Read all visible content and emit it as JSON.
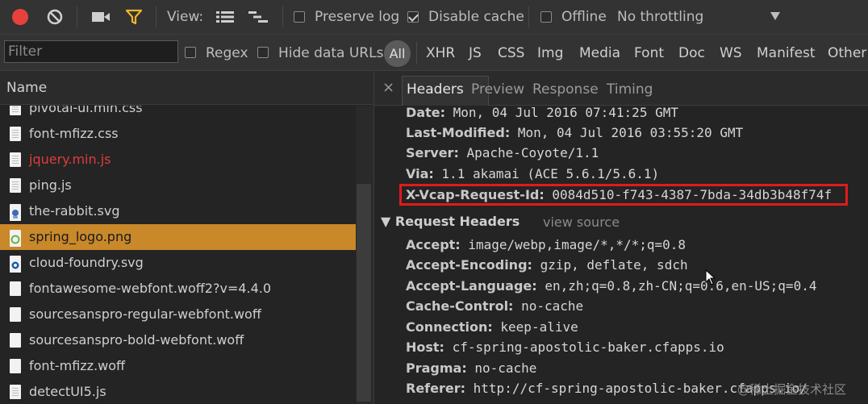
{
  "toolbar": {
    "view_label": "View:",
    "preserve_log": {
      "label": "Preserve log",
      "checked": false
    },
    "disable_cache": {
      "label": "Disable cache",
      "checked": true
    },
    "offline": {
      "label": "Offline",
      "checked": false
    },
    "throttling": "No throttling"
  },
  "filter_bar": {
    "filter_placeholder": "Filter",
    "regex": {
      "label": "Regex",
      "checked": false
    },
    "hide_data_urls": {
      "label": "Hide data URLs",
      "checked": false
    },
    "types": [
      "All",
      "XHR",
      "JS",
      "CSS",
      "Img",
      "Media",
      "Font",
      "Doc",
      "WS",
      "Manifest",
      "Other"
    ],
    "active_type": "All"
  },
  "request_list": {
    "header": "Name",
    "items": [
      {
        "name": "pivotal-ui.min.css",
        "icon": "doc-icon"
      },
      {
        "name": "font-mfizz.css",
        "icon": "doc-icon"
      },
      {
        "name": "jquery.min.js",
        "icon": "doc-icon",
        "status": "error"
      },
      {
        "name": "ping.js",
        "icon": "doc-icon"
      },
      {
        "name": "the-rabbit.svg",
        "icon": "svg-image-icon"
      },
      {
        "name": "spring_logo.png",
        "icon": "spring-logo-icon",
        "selected": true
      },
      {
        "name": "cloud-foundry.svg",
        "icon": "svg-image-icon"
      },
      {
        "name": "fontawesome-webfont.woff2?v=4.4.0",
        "icon": "blank-file-icon"
      },
      {
        "name": "sourcesanspro-regular-webfont.woff",
        "icon": "blank-file-icon"
      },
      {
        "name": "sourcesanspro-bold-webfont.woff",
        "icon": "blank-file-icon"
      },
      {
        "name": "font-mfizz.woff",
        "icon": "blank-file-icon"
      },
      {
        "name": "detectUI5.js",
        "icon": "doc-icon"
      }
    ]
  },
  "detail": {
    "tabs": [
      "Headers",
      "Preview",
      "Response",
      "Timing"
    ],
    "active_tab": "Headers",
    "response_headers": [
      {
        "key": "Date:",
        "value": "Mon, 04 Jul 2016 07:41:25 GMT"
      },
      {
        "key": "Last-Modified:",
        "value": "Mon, 04 Jul 2016 03:55:20 GMT"
      },
      {
        "key": "Server:",
        "value": "Apache-Coyote/1.1"
      },
      {
        "key": "Via:",
        "value": "1.1 akamai (ACE 5.6.1/5.6.1)"
      },
      {
        "key": "X-Vcap-Request-Id:",
        "value": "0084d510-f743-4387-7bda-34db3b48f74f"
      }
    ],
    "request_section_title": "▼ Request Headers",
    "view_source": "view source",
    "request_headers": [
      {
        "key": "Accept:",
        "value": "image/webp,image/*,*/*;q=0.8"
      },
      {
        "key": "Accept-Encoding:",
        "value": "gzip, deflate, sdch"
      },
      {
        "key": "Accept-Language:",
        "value": "en,zh;q=0.8,zh-CN;q=0.6,en-US;q=0.4"
      },
      {
        "key": "Cache-Control:",
        "value": "no-cache"
      },
      {
        "key": "Connection:",
        "value": "keep-alive"
      },
      {
        "key": "Host:",
        "value": "cf-spring-apostolic-baker.cfapps.io"
      },
      {
        "key": "Pragma:",
        "value": "no-cache"
      },
      {
        "key": "Referer:",
        "value": "http://cf-spring-apostolic-baker.cfapps.io/"
      }
    ]
  },
  "watermark": "@稀土掘金技术社区",
  "colors": {
    "record_red": "#e8413b",
    "filter_yellow": "#f0b428",
    "selected_row": "#c9882a",
    "highlight_border": "#e01b1b",
    "error_text": "#e03c3c"
  }
}
